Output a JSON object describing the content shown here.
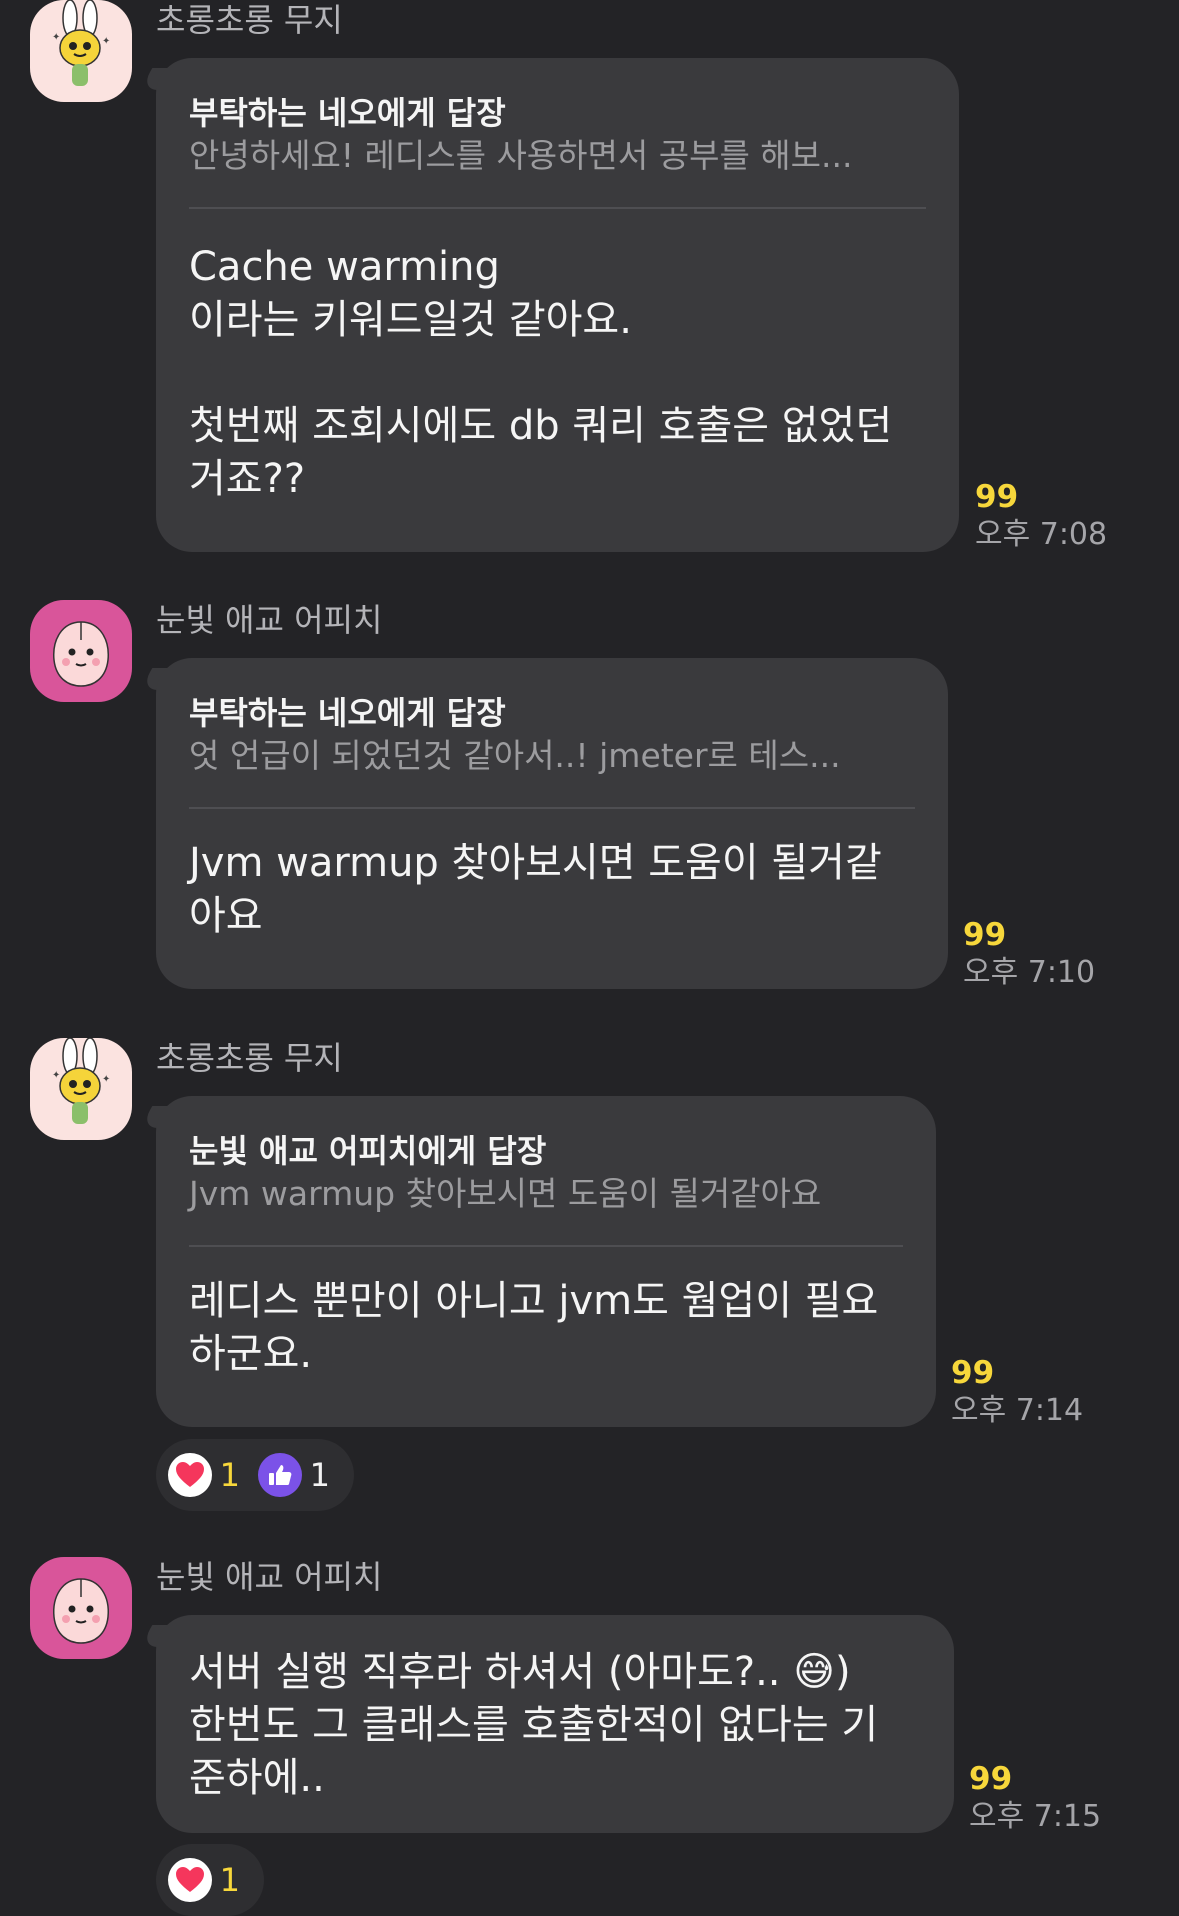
{
  "messages": [
    {
      "sender": "초롱초롱 무지",
      "avatar": "muzi-rabbit-avatar",
      "reply_title": "부탁하는 네오에게 답장",
      "reply_preview": "안녕하세요! 레디스를 사용하면서 공부를 해보...",
      "text": "Cache warming\n이라는 키워드일것 같아요.\n\n첫번째 조회시에도 db 쿼리 호출은 없었던\n거죠??",
      "unread": "99",
      "time": "오후 7:08"
    },
    {
      "sender": "눈빛 애교 어피치",
      "avatar": "apeach-avatar",
      "reply_title": "부탁하는 네오에게 답장",
      "reply_preview": "엇 언급이 되었던것 같아서..! jmeter로 테스...",
      "text": "Jvm warmup 찾아보시면 도움이 될거같\n아요",
      "unread": "99",
      "time": "오후 7:10"
    },
    {
      "sender": "초롱초롱 무지",
      "avatar": "muzi-rabbit-avatar",
      "reply_title": "눈빛 애교 어피치에게 답장",
      "reply_preview": "Jvm warmup 찾아보시면 도움이 될거같아요",
      "text": "레디스 뿐만이 아니고 jvm도 웜업이 필요\n하군요.",
      "unread": "99",
      "time": "오후 7:14",
      "reactions": [
        {
          "icon": "heart-icon",
          "count": "1",
          "color": "#f7d73b"
        },
        {
          "icon": "thumbs-up-icon",
          "count": "1",
          "color": "#f2f2f2"
        }
      ]
    },
    {
      "sender": "눈빛 애교 어피치",
      "avatar": "apeach-avatar",
      "text": "서버 실행 직후라 하셔서 (아마도?..  😅)\n한번도 그 클래스를 호출한적이 없다는 기\n준하에..",
      "unread": "99",
      "time": "오후 7:15",
      "reactions": [
        {
          "icon": "heart-icon",
          "count": "1",
          "color": "#f7d73b"
        }
      ]
    }
  ],
  "colors": {
    "background": "#232326",
    "bubble": "#3a3a3d",
    "unread": "#f7d73b",
    "heart": "#f5365c",
    "thumbs": "#7b52e8"
  }
}
